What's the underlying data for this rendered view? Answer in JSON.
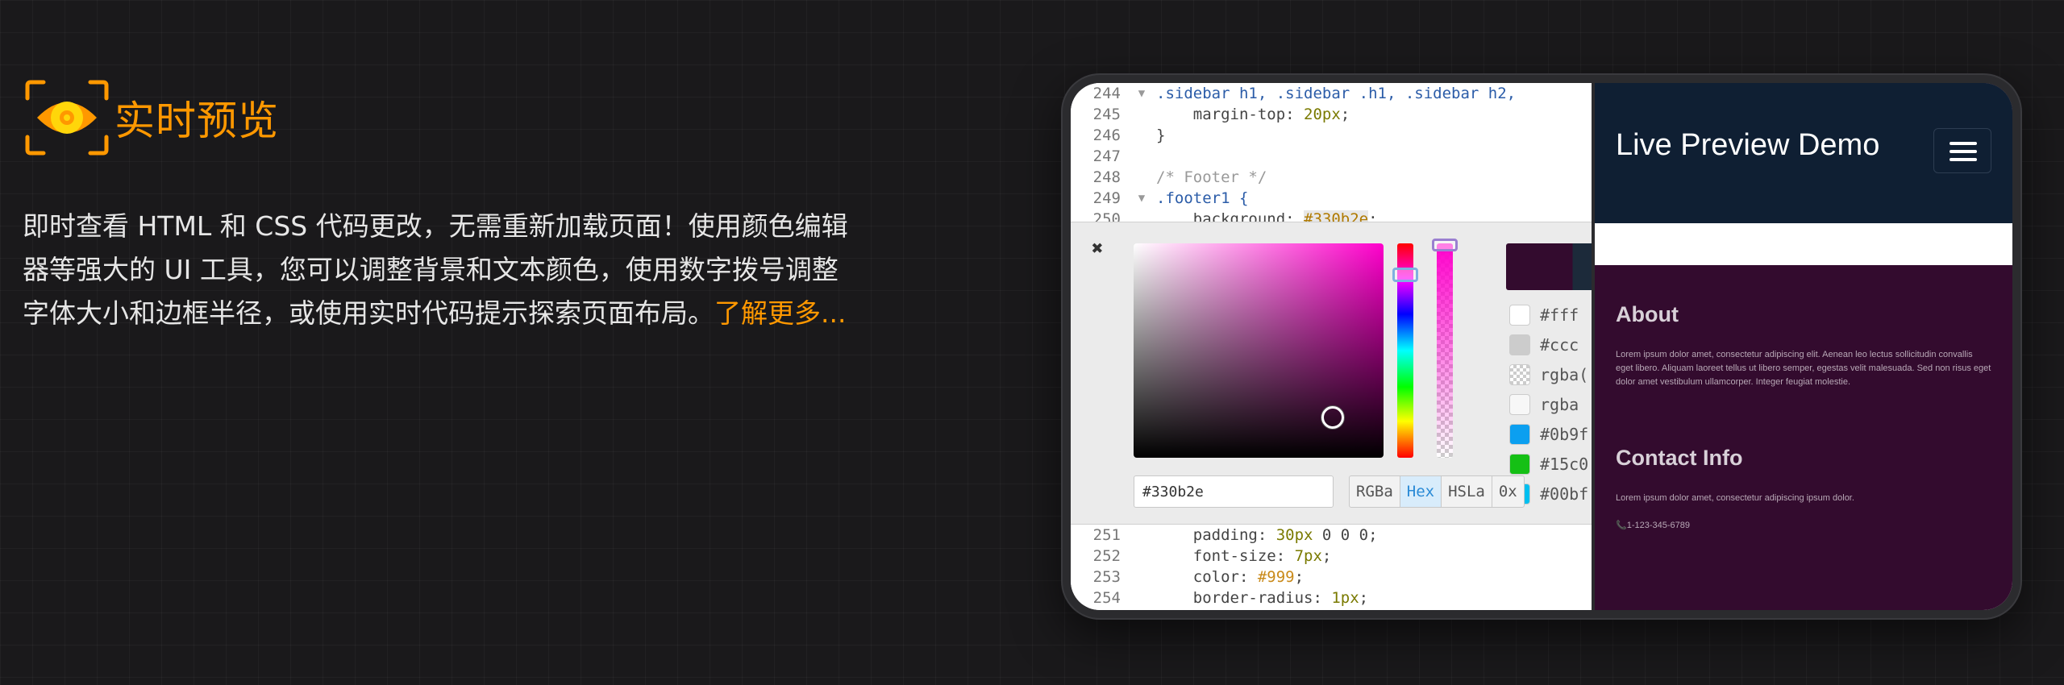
{
  "promo": {
    "title": "实时预览",
    "description": "即时查看 HTML 和 CSS 代码更改，无需重新加载页面！使用颜色编辑器等强大的 UI 工具，您可以调整背景和文本颜色，使用数字拨号调整字体大小和边框半径，或使用实时代码提示探索页面布局。",
    "link": "了解更多...",
    "accent_color": "#ff9800"
  },
  "editor": {
    "top_lines": [
      {
        "num": "244",
        "fold": "▼",
        "code": ".sidebar h1, .sidebar .h1, .sidebar h2,"
      },
      {
        "num": "245",
        "fold": "",
        "code": "    margin-top: ",
        "value": "20px",
        "end": ";"
      },
      {
        "num": "246",
        "fold": "",
        "code": "}"
      },
      {
        "num": "247",
        "fold": "",
        "code": ""
      },
      {
        "num": "248",
        "fold": "",
        "code": "/* Footer */"
      },
      {
        "num": "249",
        "fold": "▼",
        "code": ".footer1 {"
      },
      {
        "num": "250",
        "fold": "",
        "code": "    background: ",
        "value": "#330b2e",
        "end": ";"
      }
    ],
    "bottom_lines": [
      {
        "num": "251",
        "fold": "",
        "code": "    padding: ",
        "value": "30px",
        "end": " 0 0 0;"
      },
      {
        "num": "252",
        "fold": "",
        "code": "    font-size: ",
        "value": "7px",
        "end": ";"
      },
      {
        "num": "253",
        "fold": "",
        "code": "    color: ",
        "value": "#999",
        "end": ";"
      },
      {
        "num": "254",
        "fold": "",
        "code": "    border-radius: ",
        "value": "1px",
        "end": ";"
      }
    ],
    "picker": {
      "close": "✖",
      "hex_value": "#330b2e",
      "modes": [
        "RGBa",
        "Hex",
        "HSLa",
        "0x"
      ],
      "active_mode": "Hex",
      "palette": [
        {
          "label": "#fff",
          "color": "#ffffff"
        },
        {
          "label": "#ccc",
          "color": "#cccccc"
        },
        {
          "label": "rgba(",
          "color": "checker"
        },
        {
          "label": "rgba",
          "color": "#f7f7f7"
        },
        {
          "label": "#0b9f",
          "color": "#0b9ff0"
        },
        {
          "label": "#15c0",
          "color": "#15c015"
        },
        {
          "label": "#00bf",
          "color": "#00bff0"
        }
      ],
      "swatch_color": "#330b2e"
    }
  },
  "preview": {
    "title": "Live Preview Demo",
    "about_heading": "About",
    "about_text": "Lorem ipsum dolor amet, consectetur adipiscing elit. Aenean leo lectus sollicitudin convallis eget libero. Aliquam laoreet tellus ut libero semper, egestas velit malesuada. Sed non risus eget dolor amet vestibulum ullamcorper. Integer feugiat molestie.",
    "contact_heading": "Contact Info",
    "contact_text": "Lorem ipsum dolor amet, consectetur adipiscing ipsum dolor.",
    "phone": "📞1-123-345-6789",
    "footer_color": "#330b2e",
    "header_color": "#0f1f33"
  }
}
